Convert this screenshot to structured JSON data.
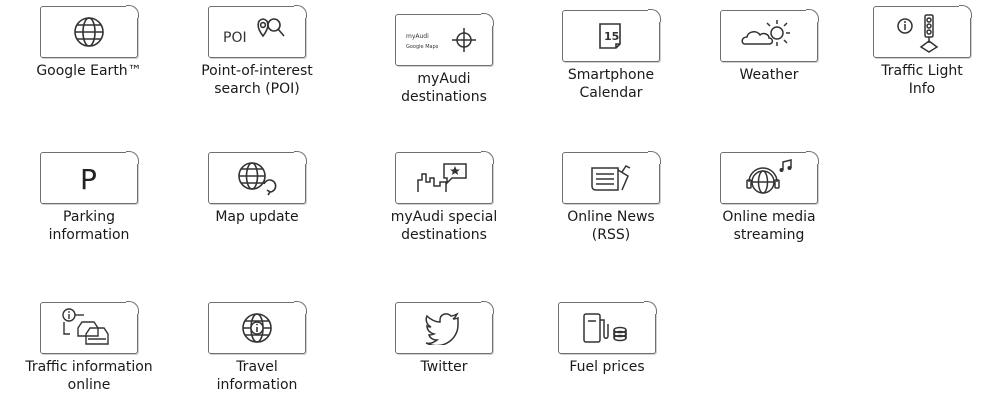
{
  "tiles": [
    {
      "label": "Google Earth™",
      "icon": "globe-icon"
    },
    {
      "label": "Point-of-interest\nsearch (POI)",
      "icon": "poi-search-icon",
      "icon_text": "POI"
    },
    {
      "label": "myAudi\ndestinations",
      "icon": "myaudi-destinations-icon",
      "icon_text_1": "myAudi",
      "icon_text_2": "Google Maps"
    },
    {
      "label": "Smartphone\nCalendar",
      "icon": "calendar-icon",
      "icon_text": "15"
    },
    {
      "label": "Weather",
      "icon": "weather-icon"
    },
    {
      "label": "Traffic Light\nInfo",
      "icon": "traffic-light-icon"
    },
    {
      "label": "Parking\ninformation",
      "icon": "parking-icon",
      "icon_text": "P"
    },
    {
      "label": "Map update",
      "icon": "map-update-icon"
    },
    {
      "label": "myAudi special\ndestinations",
      "icon": "special-destinations-icon"
    },
    {
      "label": "Online News\n(RSS)",
      "icon": "news-icon"
    },
    {
      "label": "Online media\nstreaming",
      "icon": "media-streaming-icon"
    },
    {
      "label": "Traffic information\nonline",
      "icon": "traffic-online-icon"
    },
    {
      "label": "Travel\ninformation",
      "icon": "travel-info-icon"
    },
    {
      "label": "Twitter",
      "icon": "twitter-icon"
    },
    {
      "label": "Fuel prices",
      "icon": "fuel-prices-icon"
    }
  ]
}
